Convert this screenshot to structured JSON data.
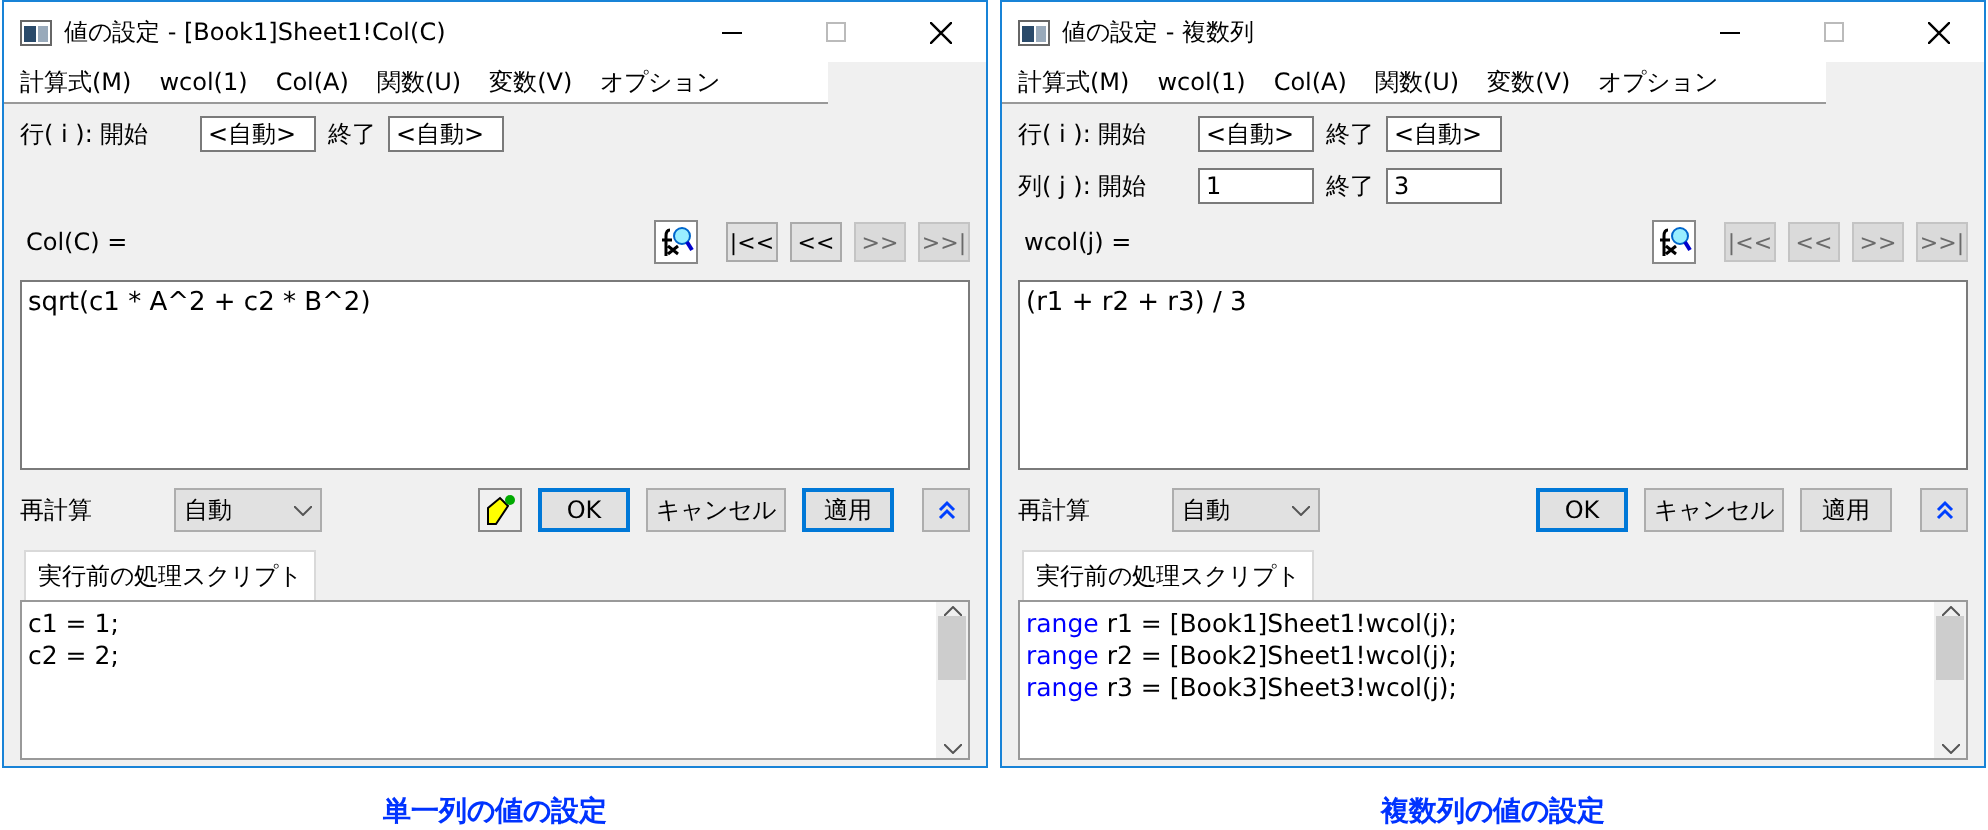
{
  "dialogs": [
    {
      "title": "値の設定 - [Book1]Sheet1!Col(C)",
      "menu": [
        "計算式(M)",
        "wcol(1)",
        "Col(A)",
        "関数(U)",
        "変数(V)",
        "オプション"
      ],
      "row_range": {
        "label": "行( i ): 開始",
        "start": "<自動>",
        "end_label": "終了",
        "end": "<自動>"
      },
      "formula_label": "Col(C) =",
      "formula": "sqrt(c1 * A^2 + c2 * B^2)",
      "nav": [
        {
          "label": "|<<",
          "disabled": false
        },
        {
          "label": "<<",
          "disabled": false
        },
        {
          "label": ">>",
          "disabled": true
        },
        {
          "label": ">>|",
          "disabled": true
        }
      ],
      "recalc_label": "再計算",
      "recalc_value": "自動",
      "brush_button": true,
      "buttons": [
        {
          "label": "OK",
          "focused": true
        },
        {
          "label": "キャンセル",
          "focused": false
        },
        {
          "label": "適用",
          "focused": true
        }
      ],
      "script_tab": "実行前の処理スクリプト",
      "script_lines": [
        {
          "text": "c1 = 1;"
        },
        {
          "text": "c2 = 2;"
        }
      ],
      "caption": "単一列の値の設定"
    },
    {
      "title": "値の設定 - 複数列",
      "menu": [
        "計算式(M)",
        "wcol(1)",
        "Col(A)",
        "関数(U)",
        "変数(V)",
        "オプション"
      ],
      "row_range": {
        "label": "行( i ): 開始",
        "start": "<自動>",
        "end_label": "終了",
        "end": "<自動>"
      },
      "col_range": {
        "label": "列( j ): 開始",
        "start": "1",
        "end_label": "終了",
        "end": "3"
      },
      "formula_label": "wcol(j) =",
      "formula": "(r1 + r2 + r3) / 3",
      "nav": [
        {
          "label": "|<<",
          "disabled": true
        },
        {
          "label": "<<",
          "disabled": true
        },
        {
          "label": ">>",
          "disabled": true
        },
        {
          "label": ">>|",
          "disabled": true
        }
      ],
      "recalc_label": "再計算",
      "recalc_value": "自動",
      "brush_button": false,
      "buttons": [
        {
          "label": "OK",
          "focused": true
        },
        {
          "label": "キャンセル",
          "focused": false
        },
        {
          "label": "適用",
          "focused": false
        }
      ],
      "script_tab": "実行前の処理スクリプト",
      "script_lines": [
        {
          "keyword": "range",
          "text": " r1 = [Book1]Sheet1!wcol(j);"
        },
        {
          "keyword": "range",
          "text": " r2 = [Book2]Sheet1!wcol(j);"
        },
        {
          "keyword": "range",
          "text": " r3 = [Book3]Sheet3!wcol(j);"
        }
      ],
      "caption": "複数列の値の設定"
    }
  ]
}
